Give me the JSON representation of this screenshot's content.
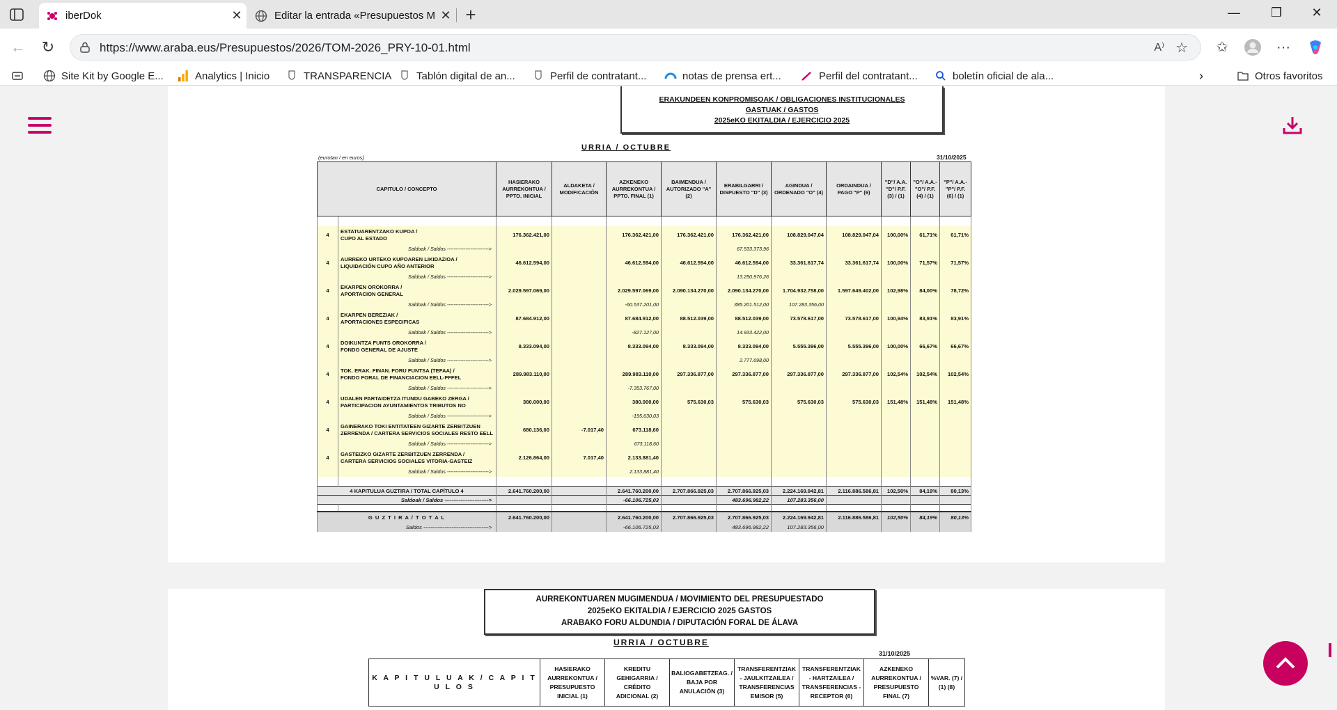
{
  "browser": {
    "tabs": [
      {
        "title": "iberDok",
        "active": true
      },
      {
        "title": "Editar la entrada «Presupuestos M",
        "active": false
      }
    ],
    "url": "https://www.araba.eus/Presupuestos/2026/TOM-2026_PRY-10-01.html",
    "bookmarks": [
      {
        "label": "Site Kit by Google E...",
        "icon": "globe-icon"
      },
      {
        "label": "Analytics | Inicio",
        "icon": "analytics-icon"
      },
      {
        "label": "TRANSPARENCIA",
        "icon": "crest-icon"
      },
      {
        "label": "Tablón digital de an...",
        "icon": "crest-icon"
      },
      {
        "label": "Perfil de contratant...",
        "icon": "crest-icon"
      },
      {
        "label": "notas de prensa ert...",
        "icon": "cloud-icon"
      },
      {
        "label": "Perfil del contratant...",
        "icon": "pen-icon"
      },
      {
        "label": "boletín oficial de ala...",
        "icon": "search-icon"
      }
    ],
    "other_favorites": "Otros favoritos"
  },
  "report1": {
    "title_lines": [
      "ERAKUNDEEN KONPROMISOAK / OBLIGACIONES INSTITUCIONALES",
      "GASTUAK / GASTOS",
      "2025eKO EKITALDIA / EJERCICIO 2025"
    ],
    "month": "URRIA / OCTUBRE",
    "unit_note": "(eurotan / en euros)",
    "date": "31/10/2025",
    "headers": [
      "CAPITULO / CONCEPTO",
      "HASIERAKO AURREKONTUA / PPTO. INICIAL",
      "ALDAKETA / MODIFICACIÓN",
      "AZKENEKO AURREKONTUA / PPTO. FINAL (1)",
      "BAIMENDUA / AUTORIZADO \"A\" (2)",
      "ERABILGARRI / DISPUESTO \"D\" (3)",
      "AGINDUA / ORDENADO \"O\" (4)",
      "ORDAINDUA / PAGO \"P\" (6)",
      "\"D\"/ A.A. \"D\"/ P.F. (3) / (1)",
      "\"O\"/ A.A.- \"O\"/ P.F. (4) / (1)",
      "\"P\"/ A.A.- \"P\"/ P.F. (6) / (1)"
    ],
    "saldos_label": "Saldoak / Saldos ------------------------->",
    "rows": [
      {
        "code": "4",
        "concept1": "ESTATUARENTZAKO KUPOA /",
        "concept2": "CUPO AL ESTADO",
        "inicial": "176.362.421,00",
        "modif": "",
        "final": "176.362.421,00",
        "autorizado": "176.362.421,00",
        "dispuesto": "176.362.421,00",
        "ordenado": "108.829.047,04",
        "pago": "108.829.047,04",
        "p1": "100,00%",
        "p2": "61,71%",
        "p3": "61,71%",
        "s_final": "",
        "s_disp": "67.533.373,96",
        "s_ord": ""
      },
      {
        "code": "4",
        "concept1": "AURREKO URTEKO KUPOAREN LIKIDAZIOA /",
        "concept2": "LIQUIDACIÓN CUPO AÑO ANTERIOR",
        "inicial": "46.612.594,00",
        "modif": "",
        "final": "46.612.594,00",
        "autorizado": "46.612.594,00",
        "dispuesto": "46.612.594,00",
        "ordenado": "33.361.617,74",
        "pago": "33.361.617,74",
        "p1": "100,00%",
        "p2": "71,57%",
        "p3": "71,57%",
        "s_final": "",
        "s_disp": "13.250.976,26",
        "s_ord": ""
      },
      {
        "code": "4",
        "concept1": "EKARPEN OROKORRA /",
        "concept2": "APORTACION GENERAL",
        "inicial": "2.029.597.069,00",
        "modif": "",
        "final": "2.029.597.069,00",
        "autorizado": "2.090.134.270,00",
        "dispuesto": "2.090.134.270,00",
        "ordenado": "1.704.932.758,00",
        "pago": "1.597.649.402,00",
        "p1": "102,98%",
        "p2": "84,00%",
        "p3": "78,72%",
        "s_final": "-60.537.201,00",
        "s_disp": "385.201.512,00",
        "s_ord": "107.283.356,00"
      },
      {
        "code": "4",
        "concept1": "EKARPEN BEREZIAK /",
        "concept2": "APORTACIONES ESPECIFICAS",
        "inicial": "87.684.912,00",
        "modif": "",
        "final": "87.684.912,00",
        "autorizado": "88.512.039,00",
        "dispuesto": "88.512.039,00",
        "ordenado": "73.578.617,00",
        "pago": "73.578.617,00",
        "p1": "100,94%",
        "p2": "83,91%",
        "p3": "83,91%",
        "s_final": "-827.127,00",
        "s_disp": "14.933.422,00",
        "s_ord": ""
      },
      {
        "code": "4",
        "concept1": "DOIKUNTZA FUNTS OROKORRA /",
        "concept2": "FONDO GENERAL DE AJUSTE",
        "inicial": "8.333.094,00",
        "modif": "",
        "final": "8.333.094,00",
        "autorizado": "8.333.094,00",
        "dispuesto": "8.333.094,00",
        "ordenado": "5.555.396,00",
        "pago": "5.555.396,00",
        "p1": "100,00%",
        "p2": "66,67%",
        "p3": "66,67%",
        "s_final": "",
        "s_disp": "2.777.698,00",
        "s_ord": ""
      },
      {
        "code": "4",
        "concept1": "TOK. ERAK. FINAN. FORU FUNTSA (TEFAA) /",
        "concept2": " FONDO FORAL DE FINANCIACION EELL-FFFEL",
        "inicial": "289.983.110,00",
        "modif": "",
        "final": "289.983.110,00",
        "autorizado": "297.336.877,00",
        "dispuesto": "297.336.877,00",
        "ordenado": "297.336.877,00",
        "pago": "297.336.877,00",
        "p1": "102,54%",
        "p2": "102,54%",
        "p3": "102,54%",
        "s_final": "-7.353.767,00",
        "s_disp": "",
        "s_ord": ""
      },
      {
        "code": "4",
        "concept1": "UDALEN PARTAIDETZA ITUNDU GABEKO ZERGA /",
        "concept2": "PARTICIPACION AYUNTAMIENTOS TRIBUTOS NO",
        "inicial": "380.000,00",
        "modif": "",
        "final": "380.000,00",
        "autorizado": "575.630,03",
        "dispuesto": "575.630,03",
        "ordenado": "575.630,03",
        "pago": "575.630,03",
        "p1": "151,48%",
        "p2": "151,48%",
        "p3": "151,48%",
        "s_final": "-195.630,03",
        "s_disp": "",
        "s_ord": ""
      },
      {
        "code": "4",
        "concept1": "GAINERAKO TOKI ENTITATEEN GIZARTE ZERBITZUEN",
        "concept2": "ZERRENDA / CARTERA SERVICIOS SOCIALES RESTO EELL",
        "inicial": "680.136,00",
        "modif": "-7.017,40",
        "final": "673.118,60",
        "autorizado": "",
        "dispuesto": "",
        "ordenado": "",
        "pago": "",
        "p1": "",
        "p2": "",
        "p3": "",
        "s_final": "673.118,60",
        "s_disp": "",
        "s_ord": ""
      },
      {
        "code": "4",
        "concept1": "GASTEIZKO GIZARTE ZERBITZUEN ZERRENDA /",
        "concept2": "CARTERA SERVICIOS SOCIALES VITORIA-GASTEIZ",
        "inicial": "2.126.864,00",
        "modif": "7.017,40",
        "final": "2.133.881,40",
        "autorizado": "",
        "dispuesto": "",
        "ordenado": "",
        "pago": "",
        "p1": "",
        "p2": "",
        "p3": "",
        "s_final": "2.133.881,40",
        "s_disp": "",
        "s_ord": ""
      }
    ],
    "total_cap": {
      "label": "4 KAPITULUA GUZTIRA / TOTAL CAPÍTULO 4",
      "saldos": "Saldoak / Saldos ------------------------->",
      "inicial": "2.641.760.200,00",
      "final": "2.641.760.200,00",
      "autorizado": "2.707.866.925,03",
      "dispuesto": "2.707.866.925,03",
      "ordenado": "2.224.169.942,81",
      "pago": "2.116.886.586,81",
      "p1": "102,50%",
      "p2": "84,19%",
      "p3": "80,13%",
      "s_final": "-66.106.725,03",
      "s_disp": "483.696.982,22",
      "s_ord": "107.283.356,00"
    },
    "grand_total": {
      "label": "G U Z T I R A  /  T O T A L",
      "saldos": "Saldos ------------------------------------->",
      "inicial": "2.641.760.200,00",
      "final": "2.641.760.200,00",
      "autorizado": "2.707.866.925,03",
      "dispuesto": "2.707.866.925,03",
      "ordenado": "2.224.169.942,81",
      "pago": "2.116.886.586,81",
      "p1": "102,50%",
      "p2": "84,19%",
      "p3": "80,13%",
      "s_final": "-66.106.725,03",
      "s_disp": "483.696.982,22",
      "s_ord": "107.283.356,00"
    }
  },
  "report2": {
    "title_lines": [
      "AURREKONTUAREN MUGIMENDUA / MOVIMIENTO DEL PRESUPUESTADO",
      "2025eKO EKITALDIA / EJERCICIO 2025 GASTOS",
      "ARABAKO FORU ALDUNDIA / DIPUTACIÓN FORAL DE ÁLAVA"
    ],
    "month": "URRIA /  OCTUBRE",
    "date": "31/10/2025",
    "headers": [
      "K A P I T U L U A K  /  C A P I T U L O S",
      "HASIERAKO AURREKONTUA / PRESUPUESTO INICIAL (1)",
      "KREDITU GEHIGARRIA / CRÉDITO ADICIONAL (2)",
      "BALIOGABETZEAG. / BAJA POR ANULACIÓN (3)",
      "TRANSFERENTZIAK - JAULKITZAILEA / TRANSFERENCIAS EMISOR (5)",
      "TRANSFERENTZIAK - HARTZAILEA / TRANSFERENCIAS - RECEPTOR (6)",
      "AZKENEKO AURREKONTUA / PRESUPUESTO FINAL (7)",
      "%VAR. (7) / (1) (8)"
    ]
  },
  "colors": {
    "accent": "#c8006b",
    "row_fill": "#fdfbd3",
    "header_fill": "#e6e6e6"
  }
}
